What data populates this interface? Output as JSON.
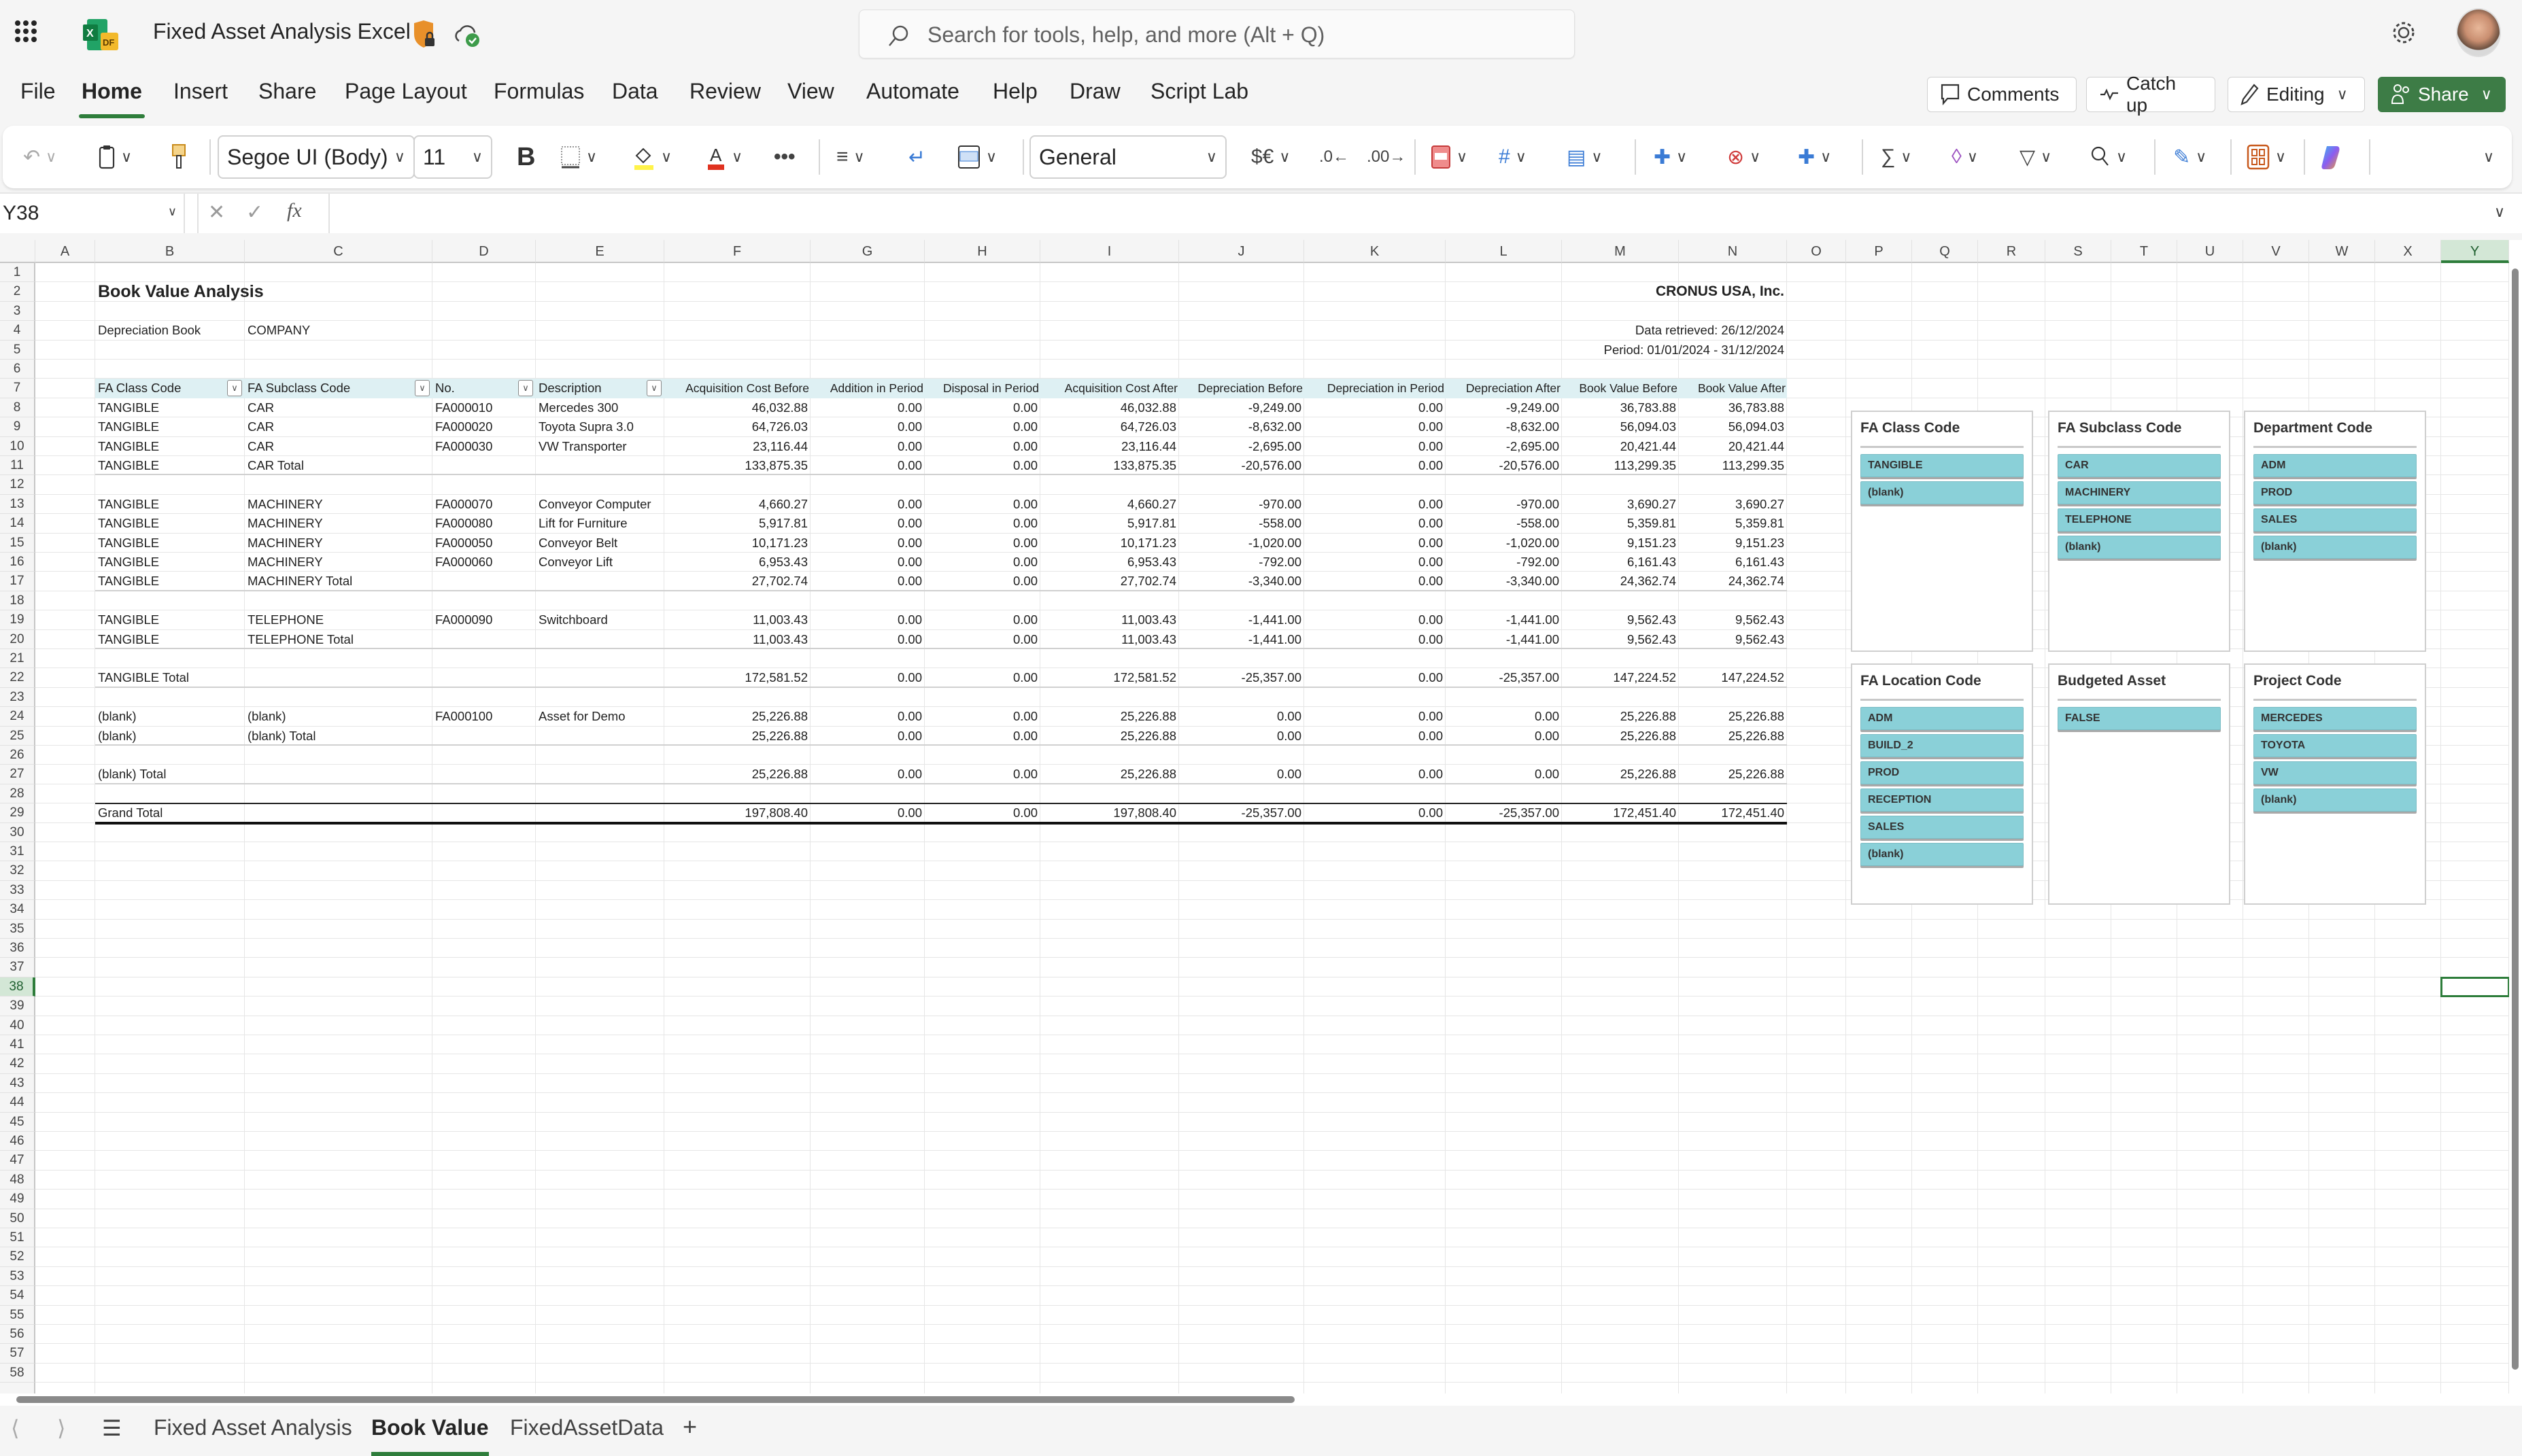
{
  "app": {
    "title": "Fixed Asset Analysis Excel",
    "search_placeholder": "Search for tools, help, and more (Alt + Q)"
  },
  "menu": {
    "tabs": [
      "File",
      "Home",
      "Insert",
      "Share",
      "Page Layout",
      "Formulas",
      "Data",
      "Review",
      "View",
      "Automate",
      "Help",
      "Draw",
      "Script Lab"
    ],
    "active": "Home",
    "comments_label": "Comments",
    "catchup_label": "Catch up",
    "editing_label": "Editing",
    "share_label": "Share"
  },
  "ribbon": {
    "font_name": "Segoe UI (Body)",
    "font_size": "11",
    "number_format": "General",
    "bold_label": "B",
    "currency_label": "$€"
  },
  "formula_bar": {
    "name_box": "Y38",
    "formula": "",
    "fx_label": "fx"
  },
  "grid": {
    "columns": [
      "A",
      "B",
      "C",
      "D",
      "E",
      "F",
      "G",
      "H",
      "I",
      "J",
      "K",
      "L",
      "M",
      "N",
      "O",
      "P",
      "Q",
      "R",
      "S",
      "T",
      "U",
      "V",
      "W",
      "X",
      "Y"
    ],
    "selected_column": "Y",
    "selected_row": 38,
    "row_count": 58
  },
  "report": {
    "title": "Book Value Analysis",
    "company": "CRONUS USA, Inc.",
    "depreciation_book_label": "Depreciation Book",
    "depreciation_book_value": "COMPANY",
    "data_retrieved": "Data retrieved: 26/12/2024",
    "period": "Period: 01/01/2024 - 31/12/2024"
  },
  "table": {
    "headers": [
      "FA Class Code",
      "FA Subclass Code",
      "No.",
      "Description",
      "Acquisition Cost Before",
      "Addition in Period",
      "Disposal in Period",
      "Acquisition Cost After",
      "Depreciation Before",
      "Depreciation in Period",
      "Depreciation After",
      "Book Value Before",
      "Book Value After"
    ],
    "rows": [
      {
        "row": 8,
        "cells": [
          "TANGIBLE",
          "CAR",
          "FA000010",
          "Mercedes 300",
          "46,032.88",
          "0.00",
          "0.00",
          "46,032.88",
          "-9,249.00",
          "0.00",
          "-9,249.00",
          "36,783.88",
          "36,783.88"
        ]
      },
      {
        "row": 9,
        "cells": [
          "TANGIBLE",
          "CAR",
          "FA000020",
          "Toyota Supra 3.0",
          "64,726.03",
          "0.00",
          "0.00",
          "64,726.03",
          "-8,632.00",
          "0.00",
          "-8,632.00",
          "56,094.03",
          "56,094.03"
        ]
      },
      {
        "row": 10,
        "cells": [
          "TANGIBLE",
          "CAR",
          "FA000030",
          "VW Transporter",
          "23,116.44",
          "0.00",
          "0.00",
          "23,116.44",
          "-2,695.00",
          "0.00",
          "-2,695.00",
          "20,421.44",
          "20,421.44"
        ]
      },
      {
        "row": 11,
        "cells": [
          "TANGIBLE",
          "CAR Total",
          "",
          "",
          "133,875.35",
          "0.00",
          "0.00",
          "133,875.35",
          "-20,576.00",
          "0.00",
          "-20,576.00",
          "113,299.35",
          "113,299.35"
        ]
      },
      {
        "row": 13,
        "cells": [
          "TANGIBLE",
          "MACHINERY",
          "FA000070",
          "Conveyor Computer",
          "4,660.27",
          "0.00",
          "0.00",
          "4,660.27",
          "-970.00",
          "0.00",
          "-970.00",
          "3,690.27",
          "3,690.27"
        ]
      },
      {
        "row": 14,
        "cells": [
          "TANGIBLE",
          "MACHINERY",
          "FA000080",
          "Lift for Furniture",
          "5,917.81",
          "0.00",
          "0.00",
          "5,917.81",
          "-558.00",
          "0.00",
          "-558.00",
          "5,359.81",
          "5,359.81"
        ]
      },
      {
        "row": 15,
        "cells": [
          "TANGIBLE",
          "MACHINERY",
          "FA000050",
          "Conveyor Belt",
          "10,171.23",
          "0.00",
          "0.00",
          "10,171.23",
          "-1,020.00",
          "0.00",
          "-1,020.00",
          "9,151.23",
          "9,151.23"
        ]
      },
      {
        "row": 16,
        "cells": [
          "TANGIBLE",
          "MACHINERY",
          "FA000060",
          "Conveyor Lift",
          "6,953.43",
          "0.00",
          "0.00",
          "6,953.43",
          "-792.00",
          "0.00",
          "-792.00",
          "6,161.43",
          "6,161.43"
        ]
      },
      {
        "row": 17,
        "cells": [
          "TANGIBLE",
          "MACHINERY Total",
          "",
          "",
          "27,702.74",
          "0.00",
          "0.00",
          "27,702.74",
          "-3,340.00",
          "0.00",
          "-3,340.00",
          "24,362.74",
          "24,362.74"
        ]
      },
      {
        "row": 19,
        "cells": [
          "TANGIBLE",
          "TELEPHONE",
          "FA000090",
          "Switchboard",
          "11,003.43",
          "0.00",
          "0.00",
          "11,003.43",
          "-1,441.00",
          "0.00",
          "-1,441.00",
          "9,562.43",
          "9,562.43"
        ]
      },
      {
        "row": 20,
        "cells": [
          "TANGIBLE",
          "TELEPHONE Total",
          "",
          "",
          "11,003.43",
          "0.00",
          "0.00",
          "11,003.43",
          "-1,441.00",
          "0.00",
          "-1,441.00",
          "9,562.43",
          "9,562.43"
        ]
      },
      {
        "row": 22,
        "cells": [
          "TANGIBLE Total",
          "",
          "",
          "",
          "172,581.52",
          "0.00",
          "0.00",
          "172,581.52",
          "-25,357.00",
          "0.00",
          "-25,357.00",
          "147,224.52",
          "147,224.52"
        ]
      },
      {
        "row": 24,
        "cells": [
          "(blank)",
          "(blank)",
          "FA000100",
          "Asset for Demo",
          "25,226.88",
          "0.00",
          "0.00",
          "25,226.88",
          "0.00",
          "0.00",
          "0.00",
          "25,226.88",
          "25,226.88"
        ]
      },
      {
        "row": 25,
        "cells": [
          "(blank)",
          "(blank) Total",
          "",
          "",
          "25,226.88",
          "0.00",
          "0.00",
          "25,226.88",
          "0.00",
          "0.00",
          "0.00",
          "25,226.88",
          "25,226.88"
        ]
      },
      {
        "row": 27,
        "cells": [
          "(blank) Total",
          "",
          "",
          "",
          "25,226.88",
          "0.00",
          "0.00",
          "25,226.88",
          "0.00",
          "0.00",
          "0.00",
          "25,226.88",
          "25,226.88"
        ]
      },
      {
        "row": 29,
        "cells": [
          "Grand Total",
          "",
          "",
          "",
          "197,808.40",
          "0.00",
          "0.00",
          "197,808.40",
          "-25,357.00",
          "0.00",
          "-25,357.00",
          "172,451.40",
          "172,451.40"
        ]
      }
    ]
  },
  "slicers": [
    {
      "title": "FA Class Code",
      "items": [
        "TANGIBLE",
        "(blank)"
      ]
    },
    {
      "title": "FA Subclass Code",
      "items": [
        "CAR",
        "MACHINERY",
        "TELEPHONE",
        "(blank)"
      ]
    },
    {
      "title": "Department Code",
      "items": [
        "ADM",
        "PROD",
        "SALES",
        "(blank)"
      ]
    },
    {
      "title": "FA Location Code",
      "items": [
        "ADM",
        "BUILD_2",
        "PROD",
        "RECEPTION",
        "SALES",
        "(blank)"
      ]
    },
    {
      "title": "Budgeted Asset",
      "items": [
        "FALSE"
      ]
    },
    {
      "title": "Project Code",
      "items": [
        "MERCEDES",
        "TOYOTA",
        "VW",
        "(blank)"
      ]
    }
  ],
  "sheet_tabs": {
    "tabs": [
      "Fixed Asset Analysis",
      "Book Value",
      "FixedAssetData"
    ],
    "active": "Book Value",
    "add_label": "+"
  },
  "colors": {
    "accent": "#2e7d3b",
    "share_button": "#3d7c46",
    "table_header_bg": "#def0f3",
    "slicer_item_bg": "#8ad0d8"
  }
}
